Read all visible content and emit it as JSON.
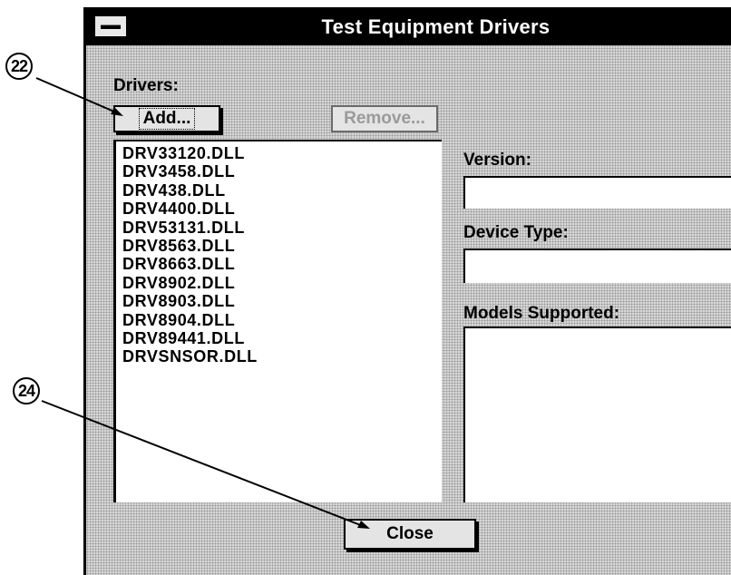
{
  "window": {
    "title": "Test Equipment Drivers"
  },
  "labels": {
    "drivers": "Drivers:",
    "version": "Version:",
    "device_type": "Device Type:",
    "models_supported": "Models Supported:"
  },
  "buttons": {
    "add": "Add...",
    "remove": "Remove...",
    "close": "Close"
  },
  "drivers": [
    "DRV33120.DLL",
    "DRV3458.DLL",
    "DRV438.DLL",
    "DRV4400.DLL",
    "DRV53131.DLL",
    "DRV8563.DLL",
    "DRV8663.DLL",
    "DRV8902.DLL",
    "DRV8903.DLL",
    "DRV8904.DLL",
    "DRV89441.DLL",
    "DRVSNSOR.DLL"
  ],
  "fields": {
    "version": "",
    "device_type": "",
    "models_supported": ""
  },
  "callouts": [
    "22",
    "24"
  ]
}
